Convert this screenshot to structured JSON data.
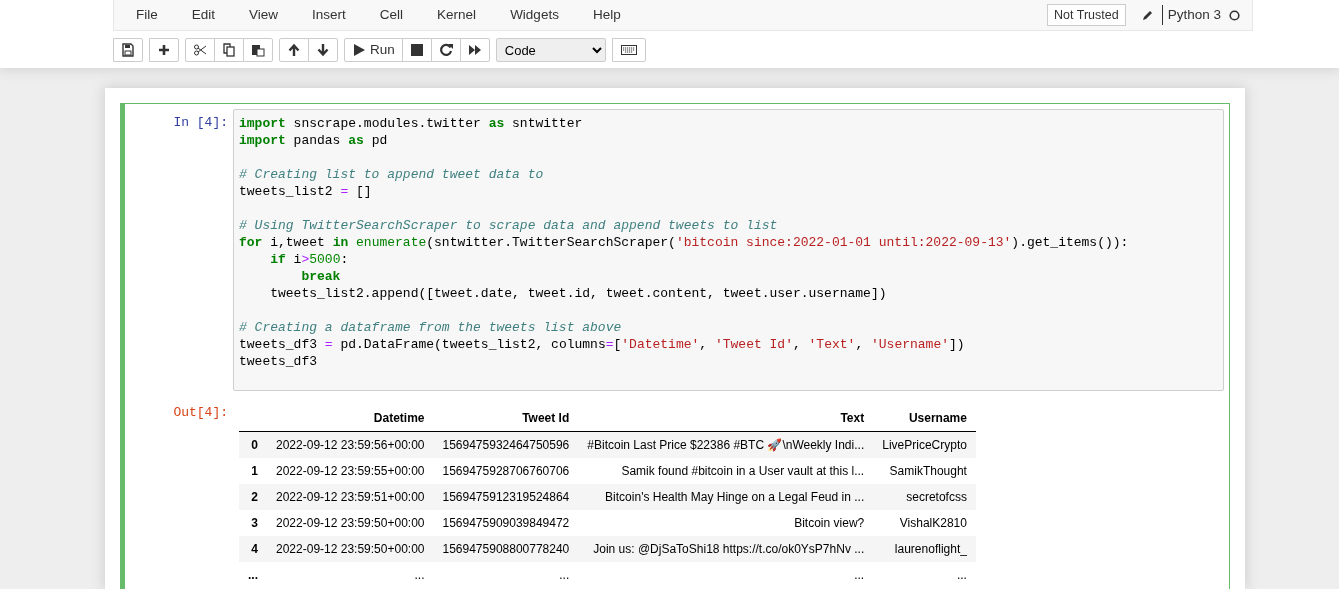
{
  "menu": [
    "File",
    "Edit",
    "View",
    "Insert",
    "Cell",
    "Kernel",
    "Widgets",
    "Help"
  ],
  "trust_button": "Not Trusted",
  "kernel": {
    "name": "Python 3"
  },
  "toolbar": {
    "groups": [
      [
        {
          "kind": "save"
        }
      ],
      [
        {
          "kind": "add"
        }
      ],
      [
        {
          "kind": "cut"
        },
        {
          "kind": "copy"
        },
        {
          "kind": "paste"
        }
      ],
      [
        {
          "kind": "up"
        },
        {
          "kind": "down"
        }
      ],
      [
        {
          "kind": "run",
          "label": "Run"
        },
        {
          "kind": "stop"
        },
        {
          "kind": "restart"
        },
        {
          "kind": "fast-forward"
        }
      ]
    ],
    "cell_type": "Code",
    "extra": [
      {
        "kind": "keyboard"
      }
    ]
  },
  "cell": {
    "selected": true,
    "prompt_in": "In [4]:",
    "prompt_out": "Out[4]:",
    "code": [
      {
        "tokens": [
          {
            "kind": "keyword",
            "text": "import"
          },
          {
            "kind": "plain",
            "text": " snscrape.modules.twitter "
          },
          {
            "kind": "keyword",
            "text": "as"
          },
          {
            "kind": "plain",
            "text": " sntwitter"
          }
        ]
      },
      {
        "tokens": [
          {
            "kind": "keyword",
            "text": "import"
          },
          {
            "kind": "plain",
            "text": " pandas "
          },
          {
            "kind": "keyword",
            "text": "as"
          },
          {
            "kind": "plain",
            "text": " pd"
          }
        ]
      },
      {
        "kind": "blank"
      },
      {
        "tokens": [
          {
            "kind": "comment",
            "text": "# Creating list to append tweet data to"
          }
        ]
      },
      {
        "tokens": [
          {
            "kind": "plain",
            "text": "tweets_list2 "
          },
          {
            "kind": "operator",
            "text": "="
          },
          {
            "kind": "plain",
            "text": " []"
          }
        ]
      },
      {
        "kind": "blank"
      },
      {
        "tokens": [
          {
            "kind": "comment",
            "text": "# Using TwitterSearchScraper to scrape data and append tweets to list"
          }
        ]
      },
      {
        "tokens": [
          {
            "kind": "keyword",
            "text": "for"
          },
          {
            "kind": "plain",
            "text": " i,tweet "
          },
          {
            "kind": "keyword",
            "text": "in"
          },
          {
            "kind": "builtin",
            "text": " enumerate"
          },
          {
            "kind": "plain",
            "text": "(sntwitter.TwitterSearchScraper("
          },
          {
            "kind": "string",
            "text": "'bitcoin since:2022-01-01 until:2022-09-13'"
          },
          {
            "kind": "plain",
            "text": ").get_items()):"
          }
        ]
      },
      {
        "tokens": [
          {
            "kind": "keyword",
            "text": "    if"
          },
          {
            "kind": "plain",
            "text": " i"
          },
          {
            "kind": "operator",
            "text": ">"
          },
          {
            "kind": "number",
            "text": "5000"
          },
          {
            "kind": "plain",
            "text": ":"
          }
        ]
      },
      {
        "tokens": [
          {
            "kind": "keyword",
            "text": "        break"
          }
        ]
      },
      {
        "tokens": [
          {
            "kind": "plain",
            "text": "    tweets_list2.append([tweet.date, tweet.id, tweet.content, tweet.user.username])"
          }
        ]
      },
      {
        "kind": "blank"
      },
      {
        "tokens": [
          {
            "kind": "comment",
            "text": "# Creating a dataframe from the tweets list above"
          }
        ]
      },
      {
        "tokens": [
          {
            "kind": "plain",
            "text": "tweets_df3 "
          },
          {
            "kind": "operator",
            "text": "="
          },
          {
            "kind": "plain",
            "text": " pd.DataFrame(tweets_list2, columns"
          },
          {
            "kind": "operator",
            "text": "="
          },
          {
            "kind": "plain",
            "text": "["
          },
          {
            "kind": "string",
            "text": "'Datetime'"
          },
          {
            "kind": "plain",
            "text": ", "
          },
          {
            "kind": "string",
            "text": "'Tweet Id'"
          },
          {
            "kind": "plain",
            "text": ", "
          },
          {
            "kind": "string",
            "text": "'Text'"
          },
          {
            "kind": "plain",
            "text": ", "
          },
          {
            "kind": "string",
            "text": "'Username'"
          },
          {
            "kind": "plain",
            "text": "])"
          }
        ]
      },
      {
        "tokens": [
          {
            "kind": "plain",
            "text": "tweets_df3"
          }
        ]
      }
    ],
    "table": {
      "columns": [
        "Datetime",
        "Tweet Id",
        "Text",
        "Username"
      ],
      "rows": [
        {
          "index": "0",
          "cells": [
            "2022-09-12 23:59:56+00:00",
            "1569475932464750596",
            "#Bitcoin Last Price $22386 #BTC 🚀\\nWeekly Indi...",
            "LivePriceCrypto"
          ]
        },
        {
          "index": "1",
          "cells": [
            "2022-09-12 23:59:55+00:00",
            "1569475928706760706",
            "Samik found #bitcoin in a User vault at this l...",
            "SamikThought"
          ]
        },
        {
          "index": "2",
          "cells": [
            "2022-09-12 23:59:51+00:00",
            "1569475912319524864",
            "Bitcoin's Health May Hinge on a Legal Feud in ...",
            "secretofcss"
          ]
        },
        {
          "index": "3",
          "cells": [
            "2022-09-12 23:59:50+00:00",
            "1569475909039849472",
            "Bitcoin view?",
            "VishalK2810"
          ]
        },
        {
          "index": "4",
          "cells": [
            "2022-09-12 23:59:50+00:00",
            "1569475908800778240",
            "Join us: @DjSaToShi18 https://t.co/ok0YsP7hNv ...",
            "laurenoflight_"
          ]
        },
        {
          "index": "...",
          "cells": [
            "...",
            "...",
            "...",
            "..."
          ]
        }
      ]
    }
  }
}
